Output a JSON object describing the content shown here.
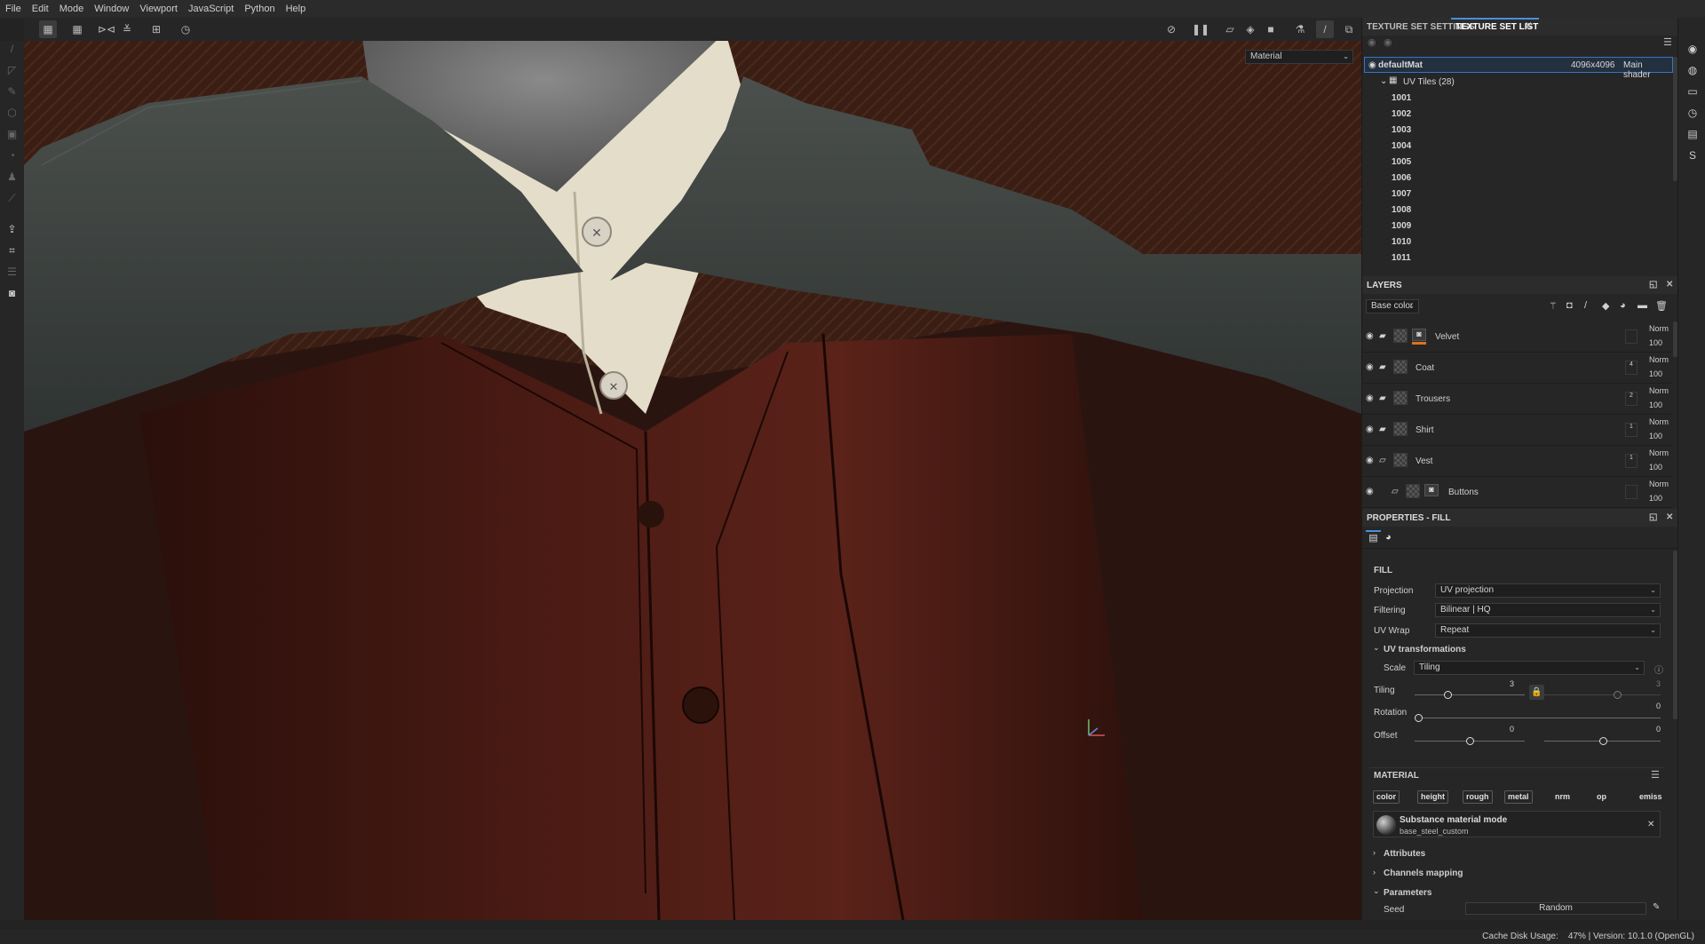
{
  "menubar": {
    "items": [
      "File",
      "Edit",
      "Mode",
      "Window",
      "Viewport",
      "JavaScript",
      "Python",
      "Help"
    ]
  },
  "toolbar": {
    "left_icons": [
      "grid-icon",
      "grid-dropdown-icon",
      "mirror-x-icon",
      "mirror-y-icon",
      "add-frame-icon",
      "history-icon"
    ],
    "right_icons": [
      "hide-icon",
      "pause-icon",
      "camera-frame-icon",
      "cube-icon",
      "video-camera-icon",
      "bake-icon",
      "paint-brush-icon",
      "screenshot-icon"
    ]
  },
  "viewport": {
    "mode_dropdown": "Material",
    "axes": {
      "x": "x",
      "y": "y",
      "z": "z"
    }
  },
  "texture_set": {
    "tab_settings": "TEXTURE SET SETTINGS",
    "tab_list": "TEXTURE SET LIST",
    "material": {
      "name": "defaultMat",
      "resolution": "4096x4096",
      "shader": "Main shader"
    },
    "uv_tiles_label": "UV Tiles (28)",
    "tiles": [
      "1001",
      "1002",
      "1003",
      "1004",
      "1005",
      "1006",
      "1007",
      "1008",
      "1009",
      "1010",
      "1011"
    ]
  },
  "layers": {
    "title": "LAYERS",
    "channel": "Base color",
    "items": [
      {
        "name": "Velvet",
        "blend": "Norm",
        "opacity": "100",
        "count": ""
      },
      {
        "name": "Coat",
        "blend": "Norm",
        "opacity": "100",
        "count": "4"
      },
      {
        "name": "Trousers",
        "blend": "Norm",
        "opacity": "100",
        "count": "2"
      },
      {
        "name": "Shirt",
        "blend": "Norm",
        "opacity": "100",
        "count": "1"
      },
      {
        "name": "Vest",
        "blend": "Norm",
        "opacity": "100",
        "count": "1"
      },
      {
        "name": "Buttons",
        "blend": "Norm",
        "opacity": "100",
        "count": ""
      }
    ]
  },
  "properties": {
    "title": "PROPERTIES - FILL",
    "fill_header": "FILL",
    "projection": {
      "label": "Projection",
      "value": "UV projection"
    },
    "filtering": {
      "label": "Filtering",
      "value": "Bilinear | HQ"
    },
    "uv_wrap": {
      "label": "UV Wrap",
      "value": "Repeat"
    },
    "uv_transformations": "UV transformations",
    "scale": {
      "label": "Scale",
      "value": "Tiling"
    },
    "tiling": {
      "label": "Tiling",
      "value": "3",
      "value2": "3",
      "fraction": 0.3
    },
    "rotation": {
      "label": "Rotation",
      "value": "0",
      "fraction": 0.0
    },
    "offset": {
      "label": "Offset",
      "value": "0",
      "value2": "0",
      "fraction": 0.5
    },
    "material_header": "MATERIAL",
    "channels": [
      {
        "label": "color",
        "active": true
      },
      {
        "label": "height",
        "active": true
      },
      {
        "label": "rough",
        "active": true
      },
      {
        "label": "metal",
        "active": true
      },
      {
        "label": "nrm",
        "active": false
      },
      {
        "label": "op",
        "active": false
      },
      {
        "label": "emiss",
        "active": false
      }
    ],
    "substance": {
      "title": "Substance material mode",
      "subtitle": "base_steel_custom"
    },
    "attributes": "Attributes",
    "channels_mapping": "Channels mapping",
    "parameters": "Parameters",
    "seed": {
      "label": "Seed",
      "value": "Random"
    }
  },
  "status": {
    "text": "Cache Disk Usage:    47% | Version: 10.1.0 (OpenGL)"
  },
  "colors": {
    "accent": "#4a90d9",
    "selection": "#2f5f9f",
    "orange": "#e0701c",
    "hood": "#3c413f",
    "vest": "#4a1b14",
    "shirt": "#e4ddc9"
  }
}
